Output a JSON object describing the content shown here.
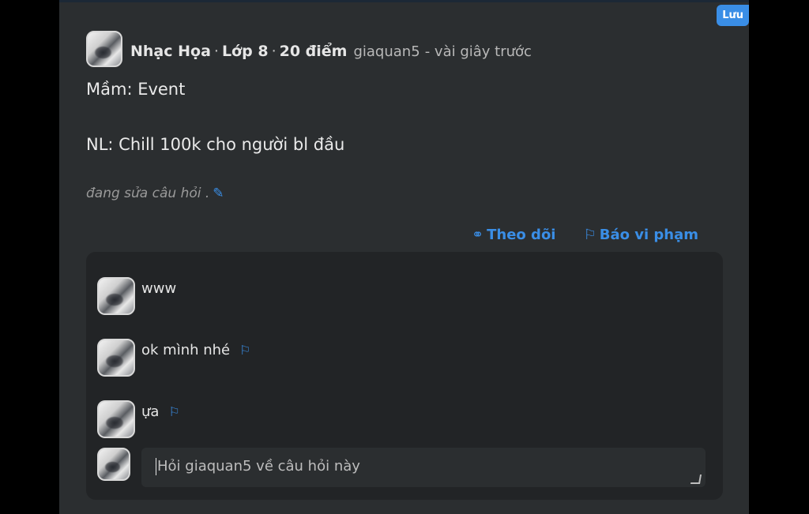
{
  "save_badge": "Lưu",
  "post": {
    "author_name": "Nhạc Họa",
    "grade": "Lớp 8",
    "points": "20 điểm",
    "username": "giaquan5",
    "time": "- vài giây trước",
    "lines": [
      "Mầm: Event",
      "NL: Chill 100k cho người bl đầu"
    ],
    "editing_note": "đang sửa câu hỏi ."
  },
  "actions": {
    "follow_label": "Theo dõi",
    "report_label": "Báo vi phạm"
  },
  "comments": [
    {
      "text": "www",
      "flag": false
    },
    {
      "text": "ok mình nhé",
      "flag": true
    },
    {
      "text": "ựa",
      "flag": true
    }
  ],
  "reply": {
    "placeholder": "Hỏi giaquan5 về câu hỏi này"
  },
  "colors": {
    "accent": "#3a8ee6",
    "card_bg": "#2b2e30",
    "comments_bg": "#222426"
  }
}
